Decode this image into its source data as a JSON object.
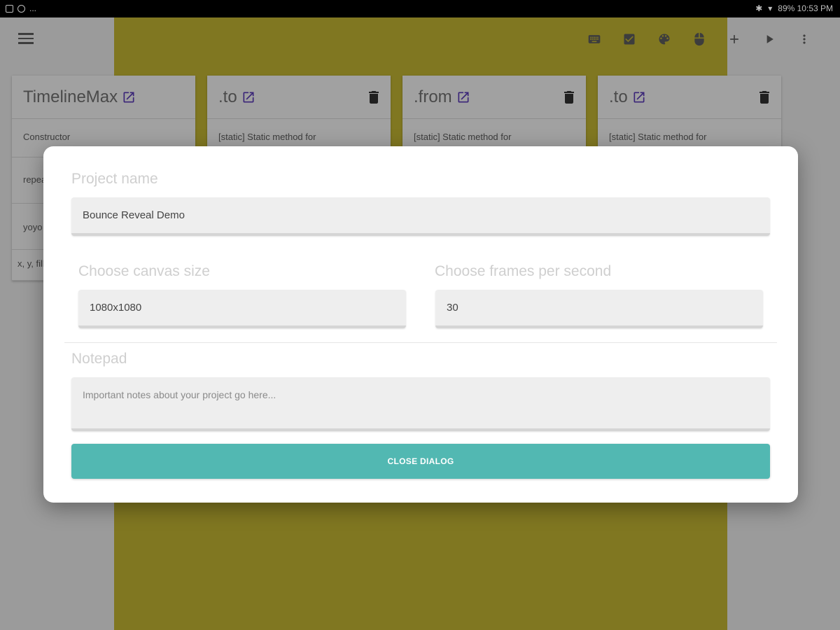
{
  "status_bar": {
    "left_text": "...",
    "right_text": "89% 10:53 PM"
  },
  "toolbar": {
    "icons": [
      "menu-icon",
      "keyboard-icon",
      "checkbox-icon",
      "palette-icon",
      "mouse-icon",
      "add-icon",
      "play-icon",
      "more-vert-icon"
    ]
  },
  "cards": [
    {
      "title": "TimelineMax",
      "rows": [
        "Constructor",
        "repeat",
        "yoyo",
        "x, y, fill"
      ],
      "deletable": false
    },
    {
      "title": ".to",
      "rows": [
        "[static] Static method for"
      ],
      "deletable": true
    },
    {
      "title": ".from",
      "rows": [
        "[static] Static method for"
      ],
      "deletable": true
    },
    {
      "title": ".to",
      "rows": [
        "[static] Static method for"
      ],
      "deletable": true
    }
  ],
  "dialog": {
    "project_name_label": "Project name",
    "project_name_value": "Bounce Reveal Demo",
    "canvas_size_label": "Choose canvas size",
    "canvas_size_value": "1080x1080",
    "fps_label": "Choose frames per second",
    "fps_value": "30",
    "notepad_label": "Notepad",
    "notepad_placeholder": "Important notes about your project go here...",
    "close_button_label": "CLOSE DIALOG"
  },
  "colors": {
    "canvas": "#cbbd35",
    "accent_button": "#52b8b2",
    "edit_icon": "#5c3bbf"
  }
}
